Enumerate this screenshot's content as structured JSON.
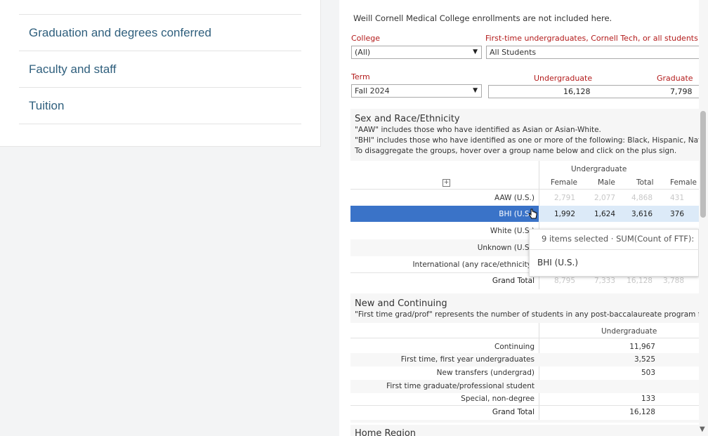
{
  "nav": {
    "items": [
      {
        "label": "Graduation and degrees conferred"
      },
      {
        "label": "Faculty and staff"
      },
      {
        "label": "Tuition"
      }
    ]
  },
  "dashboard": {
    "note": "Weill Cornell Medical College enrollments are not included here.",
    "college_label": "College",
    "college_value": "(All)",
    "student_type_label": "First-time undergraduates, Cornell Tech, or all students",
    "student_type_value": "All Students",
    "term_label": "Term",
    "term_value": "Fall 2024",
    "undergrad_label": "Undergraduate",
    "grad_label": "Graduate",
    "undergrad_total": "16,128",
    "grad_total": "7,798"
  },
  "sex_race": {
    "title": "Sex and Race/Ethnicity",
    "note1": "\"AAW\" includes those who have identified as Asian or Asian-White.",
    "note2": "\"BHI\" includes those who have identified as one or more of the following: Black, Hispanic, Native",
    "note3": "To disaggregate the groups, hover over a group name below and click on the plus sign.",
    "group_header": "Undergraduate",
    "expand_icon": "+",
    "columns": [
      "Female",
      "Male",
      "Total",
      "Female"
    ],
    "rows": [
      {
        "label": "AAW (U.S.)",
        "values": [
          "2,791",
          "2,077",
          "4,868",
          "431"
        ]
      },
      {
        "label": "BHI (U.S.)",
        "values": [
          "1,992",
          "1,624",
          "3,616",
          "376"
        ]
      },
      {
        "label": "White (U.S.)",
        "values": [
          "",
          "",
          "",
          ""
        ]
      },
      {
        "label": "Unknown (U.S.)",
        "values": [
          "",
          "",
          "",
          ""
        ]
      },
      {
        "label": "International (any race/ethnicity)",
        "values": [
          "",
          "",
          "",
          ""
        ]
      },
      {
        "label": "Grand Total",
        "values": [
          "8,795",
          "7,333",
          "16,128",
          "3,788"
        ]
      }
    ]
  },
  "tooltip": {
    "summary": "9 items selected · SUM(Count of FTF): ",
    "item": "BHI (U.S.)"
  },
  "new_cont": {
    "title": "New and Continuing",
    "note": "\"First time grad/prof\" represents the number of students in any post-baccalaureate program f",
    "col_header": "Undergraduate",
    "rows": [
      {
        "label": "Continuing",
        "value": "11,967"
      },
      {
        "label": "First time, first year undergraduates",
        "value": "3,525"
      },
      {
        "label": "New transfers (undergrad)",
        "value": "503"
      },
      {
        "label": "First time graduate/professional student",
        "value": ""
      },
      {
        "label": "Special, non-degree",
        "value": "133"
      },
      {
        "label": "Grand Total",
        "value": "16,128"
      }
    ]
  },
  "home_region": {
    "title": "Home Region"
  },
  "colors": {
    "selected_row": "#3a73c8",
    "accent_red": "#b31b1b",
    "nav_link": "#2f5f7d"
  }
}
